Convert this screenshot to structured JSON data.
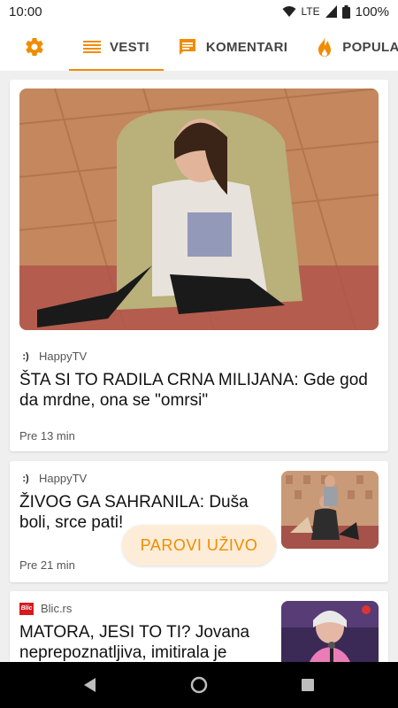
{
  "status_bar": {
    "time": "10:00",
    "network": "LTE",
    "battery": "100%",
    "icons": [
      "wifi-icon",
      "cell-signal-icon",
      "battery-icon"
    ]
  },
  "tabs": {
    "settings_icon": "gear-icon",
    "items": [
      {
        "label": "VESTI",
        "icon": "list-icon",
        "active": true
      },
      {
        "label": "KOMENTARI",
        "icon": "comment-icon",
        "active": false
      },
      {
        "label": "POPULARNO",
        "icon": "fire-icon",
        "active": false
      }
    ]
  },
  "colors": {
    "accent": "#f08c00",
    "fab_background": "#fdecd6"
  },
  "articles": [
    {
      "source": "HappyTV",
      "source_icon": "happytv-logo",
      "headline": "ŠTA SI TO RADILA CRNA MILIJANA: Gde god da mrdne, ona se \"omrsi\"",
      "time": "Pre 13 min",
      "image": "woman-in-armchair-photo"
    },
    {
      "source": "HappyTV",
      "source_icon": "happytv-logo",
      "headline": "ŽIVOG GA SAHRANILA: Duša boli, srce pati!",
      "time": "Pre 21 min",
      "image": "people-in-room-thumbnail"
    },
    {
      "source": "Blic.rs",
      "source_icon": "blic-logo",
      "source_logo_text": "Blic",
      "headline": "MATORA, JESI TO TI? Jovana neprepoznatljiva, imitirala je",
      "image": "woman-with-microphone-thumbnail"
    }
  ],
  "fab": {
    "label": "PAROVI UŽIVO"
  },
  "nav_bar": {
    "icons": [
      "back-icon",
      "home-icon",
      "recents-icon"
    ]
  }
}
